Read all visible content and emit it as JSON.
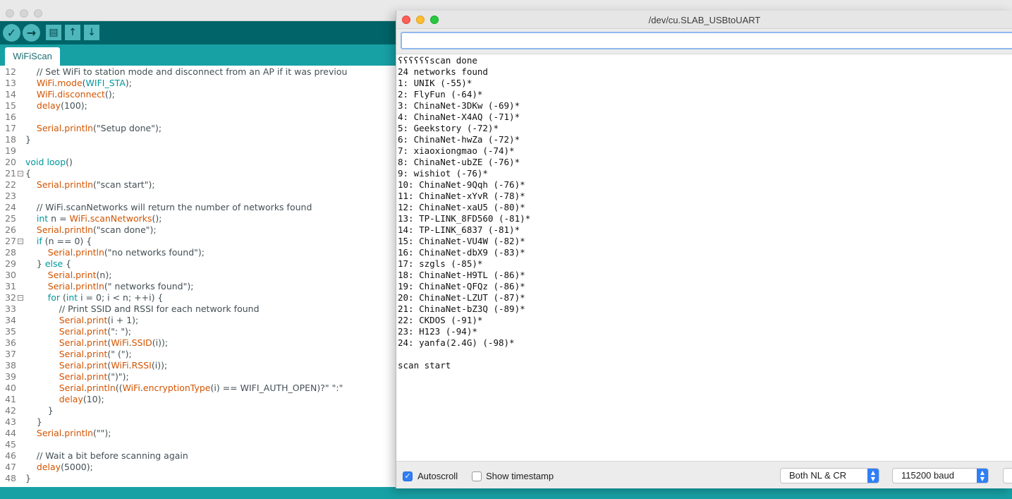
{
  "ide": {
    "tab_label": "WiFiScan",
    "toolbar": {
      "verify_icon": "checkmark-icon",
      "upload_icon": "arrow-right-icon",
      "new_icon": "document-icon",
      "open_icon": "arrow-up-icon",
      "save_icon": "arrow-down-icon"
    },
    "colors": {
      "toolbar": "#006468",
      "tabbar": "#17a1a5",
      "keyword": "#00979c",
      "function": "#d35400"
    },
    "code_lines": [
      {
        "n": "12",
        "fold": false,
        "segs": [
          {
            "t": "    // Set WiFi to station mode and disconnect from an AP if it was previou",
            "c": "cm"
          }
        ]
      },
      {
        "n": "13",
        "fold": false,
        "segs": [
          {
            "t": "    ",
            "c": ""
          },
          {
            "t": "WiFi",
            "c": "fn"
          },
          {
            "t": ".",
            "c": ""
          },
          {
            "t": "mode",
            "c": "fn"
          },
          {
            "t": "(",
            "c": ""
          },
          {
            "t": "WIFI_STA",
            "c": "kw"
          },
          {
            "t": ");",
            "c": ""
          }
        ]
      },
      {
        "n": "14",
        "fold": false,
        "segs": [
          {
            "t": "    ",
            "c": ""
          },
          {
            "t": "WiFi",
            "c": "fn"
          },
          {
            "t": ".",
            "c": ""
          },
          {
            "t": "disconnect",
            "c": "fn"
          },
          {
            "t": "();",
            "c": ""
          }
        ]
      },
      {
        "n": "15",
        "fold": false,
        "segs": [
          {
            "t": "    ",
            "c": ""
          },
          {
            "t": "delay",
            "c": "fn"
          },
          {
            "t": "(100);",
            "c": ""
          }
        ]
      },
      {
        "n": "16",
        "fold": false,
        "segs": []
      },
      {
        "n": "17",
        "fold": false,
        "segs": [
          {
            "t": "    ",
            "c": ""
          },
          {
            "t": "Serial",
            "c": "fn"
          },
          {
            "t": ".",
            "c": ""
          },
          {
            "t": "println",
            "c": "fn"
          },
          {
            "t": "(\"Setup done\");",
            "c": ""
          }
        ]
      },
      {
        "n": "18",
        "fold": false,
        "segs": [
          {
            "t": "}",
            "c": ""
          }
        ]
      },
      {
        "n": "19",
        "fold": false,
        "segs": []
      },
      {
        "n": "20",
        "fold": false,
        "segs": [
          {
            "t": "void",
            "c": "kw"
          },
          {
            "t": " ",
            "c": ""
          },
          {
            "t": "loop",
            "c": "kw"
          },
          {
            "t": "()",
            "c": ""
          }
        ]
      },
      {
        "n": "21",
        "fold": true,
        "segs": [
          {
            "t": "{",
            "c": ""
          }
        ]
      },
      {
        "n": "22",
        "fold": false,
        "segs": [
          {
            "t": "    ",
            "c": ""
          },
          {
            "t": "Serial",
            "c": "fn"
          },
          {
            "t": ".",
            "c": ""
          },
          {
            "t": "println",
            "c": "fn"
          },
          {
            "t": "(\"scan start\");",
            "c": ""
          }
        ]
      },
      {
        "n": "23",
        "fold": false,
        "segs": []
      },
      {
        "n": "24",
        "fold": false,
        "segs": [
          {
            "t": "    // WiFi.scanNetworks will return the number of networks found",
            "c": "cm"
          }
        ]
      },
      {
        "n": "25",
        "fold": false,
        "segs": [
          {
            "t": "    ",
            "c": ""
          },
          {
            "t": "int",
            "c": "kw"
          },
          {
            "t": " n = ",
            "c": ""
          },
          {
            "t": "WiFi",
            "c": "fn"
          },
          {
            "t": ".",
            "c": ""
          },
          {
            "t": "scanNetworks",
            "c": "fn"
          },
          {
            "t": "();",
            "c": ""
          }
        ]
      },
      {
        "n": "26",
        "fold": false,
        "segs": [
          {
            "t": "    ",
            "c": ""
          },
          {
            "t": "Serial",
            "c": "fn"
          },
          {
            "t": ".",
            "c": ""
          },
          {
            "t": "println",
            "c": "fn"
          },
          {
            "t": "(\"scan done\");",
            "c": ""
          }
        ]
      },
      {
        "n": "27",
        "fold": true,
        "segs": [
          {
            "t": "    ",
            "c": ""
          },
          {
            "t": "if",
            "c": "kw"
          },
          {
            "t": " (n == 0) {",
            "c": ""
          }
        ]
      },
      {
        "n": "28",
        "fold": false,
        "segs": [
          {
            "t": "        ",
            "c": ""
          },
          {
            "t": "Serial",
            "c": "fn"
          },
          {
            "t": ".",
            "c": ""
          },
          {
            "t": "println",
            "c": "fn"
          },
          {
            "t": "(\"no networks found\");",
            "c": ""
          }
        ]
      },
      {
        "n": "29",
        "fold": false,
        "segs": [
          {
            "t": "    } ",
            "c": ""
          },
          {
            "t": "else",
            "c": "kw"
          },
          {
            "t": " {",
            "c": ""
          }
        ]
      },
      {
        "n": "30",
        "fold": false,
        "segs": [
          {
            "t": "        ",
            "c": ""
          },
          {
            "t": "Serial",
            "c": "fn"
          },
          {
            "t": ".",
            "c": ""
          },
          {
            "t": "print",
            "c": "fn"
          },
          {
            "t": "(n);",
            "c": ""
          }
        ]
      },
      {
        "n": "31",
        "fold": false,
        "segs": [
          {
            "t": "        ",
            "c": ""
          },
          {
            "t": "Serial",
            "c": "fn"
          },
          {
            "t": ".",
            "c": ""
          },
          {
            "t": "println",
            "c": "fn"
          },
          {
            "t": "(\" networks found\");",
            "c": ""
          }
        ]
      },
      {
        "n": "32",
        "fold": true,
        "segs": [
          {
            "t": "        ",
            "c": ""
          },
          {
            "t": "for",
            "c": "kw"
          },
          {
            "t": " (",
            "c": ""
          },
          {
            "t": "int",
            "c": "kw"
          },
          {
            "t": " i = 0; i < n; ++i) {",
            "c": ""
          }
        ]
      },
      {
        "n": "33",
        "fold": false,
        "segs": [
          {
            "t": "            // Print SSID and RSSI for each network found",
            "c": "cm"
          }
        ]
      },
      {
        "n": "34",
        "fold": false,
        "segs": [
          {
            "t": "            ",
            "c": ""
          },
          {
            "t": "Serial",
            "c": "fn"
          },
          {
            "t": ".",
            "c": ""
          },
          {
            "t": "print",
            "c": "fn"
          },
          {
            "t": "(i + 1);",
            "c": ""
          }
        ]
      },
      {
        "n": "35",
        "fold": false,
        "segs": [
          {
            "t": "            ",
            "c": ""
          },
          {
            "t": "Serial",
            "c": "fn"
          },
          {
            "t": ".",
            "c": ""
          },
          {
            "t": "print",
            "c": "fn"
          },
          {
            "t": "(\": \");",
            "c": ""
          }
        ]
      },
      {
        "n": "36",
        "fold": false,
        "segs": [
          {
            "t": "            ",
            "c": ""
          },
          {
            "t": "Serial",
            "c": "fn"
          },
          {
            "t": ".",
            "c": ""
          },
          {
            "t": "print",
            "c": "fn"
          },
          {
            "t": "(",
            "c": ""
          },
          {
            "t": "WiFi",
            "c": "fn"
          },
          {
            "t": ".",
            "c": ""
          },
          {
            "t": "SSID",
            "c": "fn"
          },
          {
            "t": "(i));",
            "c": ""
          }
        ]
      },
      {
        "n": "37",
        "fold": false,
        "segs": [
          {
            "t": "            ",
            "c": ""
          },
          {
            "t": "Serial",
            "c": "fn"
          },
          {
            "t": ".",
            "c": ""
          },
          {
            "t": "print",
            "c": "fn"
          },
          {
            "t": "(\" (\");",
            "c": ""
          }
        ]
      },
      {
        "n": "38",
        "fold": false,
        "segs": [
          {
            "t": "            ",
            "c": ""
          },
          {
            "t": "Serial",
            "c": "fn"
          },
          {
            "t": ".",
            "c": ""
          },
          {
            "t": "print",
            "c": "fn"
          },
          {
            "t": "(",
            "c": ""
          },
          {
            "t": "WiFi",
            "c": "fn"
          },
          {
            "t": ".",
            "c": ""
          },
          {
            "t": "RSSI",
            "c": "fn"
          },
          {
            "t": "(i));",
            "c": ""
          }
        ]
      },
      {
        "n": "39",
        "fold": false,
        "segs": [
          {
            "t": "            ",
            "c": ""
          },
          {
            "t": "Serial",
            "c": "fn"
          },
          {
            "t": ".",
            "c": ""
          },
          {
            "t": "print",
            "c": "fn"
          },
          {
            "t": "(\")\");",
            "c": ""
          }
        ]
      },
      {
        "n": "40",
        "fold": false,
        "segs": [
          {
            "t": "            ",
            "c": ""
          },
          {
            "t": "Serial",
            "c": "fn"
          },
          {
            "t": ".",
            "c": ""
          },
          {
            "t": "println",
            "c": "fn"
          },
          {
            "t": "((",
            "c": ""
          },
          {
            "t": "WiFi",
            "c": "fn"
          },
          {
            "t": ".",
            "c": ""
          },
          {
            "t": "encryptionType",
            "c": "fn"
          },
          {
            "t": "(i) == WIFI_AUTH_OPEN)?\" \":\"",
            "c": ""
          }
        ]
      },
      {
        "n": "41",
        "fold": false,
        "segs": [
          {
            "t": "            ",
            "c": ""
          },
          {
            "t": "delay",
            "c": "fn"
          },
          {
            "t": "(10);",
            "c": ""
          }
        ]
      },
      {
        "n": "42",
        "fold": false,
        "segs": [
          {
            "t": "        }",
            "c": ""
          }
        ]
      },
      {
        "n": "43",
        "fold": false,
        "segs": [
          {
            "t": "    }",
            "c": ""
          }
        ]
      },
      {
        "n": "44",
        "fold": false,
        "segs": [
          {
            "t": "    ",
            "c": ""
          },
          {
            "t": "Serial",
            "c": "fn"
          },
          {
            "t": ".",
            "c": ""
          },
          {
            "t": "println",
            "c": "fn"
          },
          {
            "t": "(\"\");",
            "c": ""
          }
        ]
      },
      {
        "n": "45",
        "fold": false,
        "segs": []
      },
      {
        "n": "46",
        "fold": false,
        "segs": [
          {
            "t": "    // Wait a bit before scanning again",
            "c": "cm"
          }
        ]
      },
      {
        "n": "47",
        "fold": false,
        "segs": [
          {
            "t": "    ",
            "c": ""
          },
          {
            "t": "delay",
            "c": "fn"
          },
          {
            "t": "(5000);",
            "c": ""
          }
        ]
      },
      {
        "n": "48",
        "fold": false,
        "segs": [
          {
            "t": "}",
            "c": ""
          }
        ]
      }
    ]
  },
  "serial_monitor": {
    "title": "/dev/cu.SLAB_USBtoUART",
    "input_value": "",
    "output_lines": [
      "ʕʕʕʕʕʕscan done",
      "24 networks found",
      "1: UNIK (-55)*",
      "2: FlyFun (-64)*",
      "3: ChinaNet-3DKw (-69)*",
      "4: ChinaNet-X4AQ (-71)*",
      "5: Geekstory (-72)*",
      "6: ChinaNet-hwZa (-72)*",
      "7: xiaoxiongmao (-74)*",
      "8: ChinaNet-ubZE (-76)*",
      "9: wishiot (-76)*",
      "10: ChinaNet-9Qqh (-76)*",
      "11: ChinaNet-xYvR (-78)*",
      "12: ChinaNet-xaU5 (-80)*",
      "13: TP-LINK_8FD560 (-81)*",
      "14: TP-LINK_6837 (-81)*",
      "15: ChinaNet-VU4W (-82)*",
      "16: ChinaNet-dbX9 (-83)*",
      "17: szgls (-85)*",
      "18: ChinaNet-H9TL (-86)*",
      "19: ChinaNet-QFQz (-86)*",
      "20: ChinaNet-LZUT (-87)*",
      "21: ChinaNet-bZ3Q (-89)*",
      "22: CKDOS (-91)*",
      "23: H123 (-94)*",
      "24: yanfa(2.4G) (-98)*",
      "",
      "scan start"
    ],
    "autoscroll": {
      "label": "Autoscroll",
      "checked": true
    },
    "timestamp": {
      "label": "Show timestamp",
      "checked": false
    },
    "line_ending": "Both NL & CR",
    "baud_rate": "115200 baud",
    "colors": {
      "accent": "#2f7ef6",
      "traffic_close": "#fe5f57",
      "traffic_min": "#febc2e",
      "traffic_max": "#28c840"
    }
  }
}
